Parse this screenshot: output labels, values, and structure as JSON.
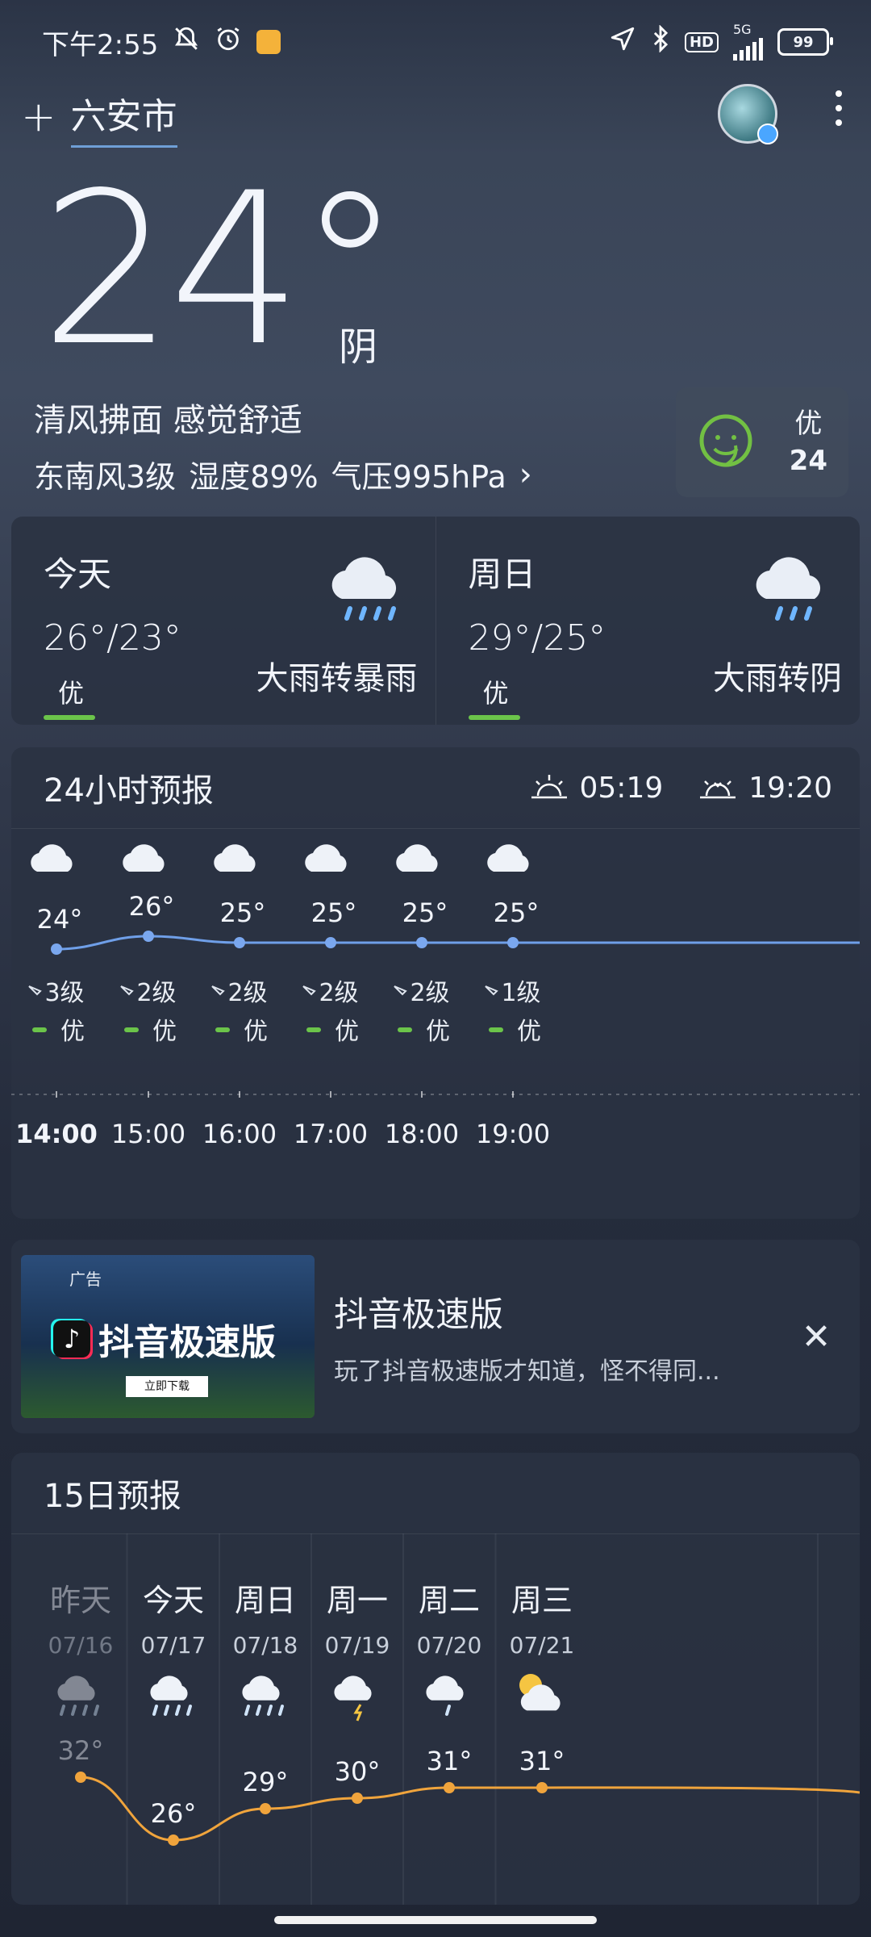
{
  "status_bar": {
    "time": "下午2:55",
    "hd": "HD",
    "network": "5G",
    "battery": "99"
  },
  "header": {
    "add": "+",
    "city": "六安市"
  },
  "current": {
    "temp": "24°",
    "condition": "阴",
    "feel": "清风拂面 感觉舒适",
    "wind": "东南风3级",
    "humidity": "湿度89%",
    "pressure": "气压995hPa",
    "aqi_label": "优",
    "aqi_value": "24"
  },
  "days": [
    {
      "name": "今天",
      "range": "26°/23°",
      "aqi": "优",
      "desc": "大雨转暴雨"
    },
    {
      "name": "周日",
      "range": "29°/25°",
      "aqi": "优",
      "desc": "大雨转阴"
    }
  ],
  "hourly": {
    "title": "24小时预报",
    "sunrise": "05:19",
    "sunset": "19:20",
    "items": [
      {
        "time": "14:00",
        "temp": "24°",
        "wind": "3级",
        "aqi": "优",
        "bold": true
      },
      {
        "time": "15:00",
        "temp": "26°",
        "wind": "2级",
        "aqi": "优"
      },
      {
        "time": "16:00",
        "temp": "25°",
        "wind": "2级",
        "aqi": "优"
      },
      {
        "time": "17:00",
        "temp": "25°",
        "wind": "2级",
        "aqi": "优"
      },
      {
        "time": "18:00",
        "temp": "25°",
        "wind": "2级",
        "aqi": "优"
      },
      {
        "time": "19:00",
        "temp": "25°",
        "wind": "1级",
        "aqi": "优"
      }
    ]
  },
  "ad": {
    "label": "广告",
    "image_title": "抖音极速版",
    "image_button": "立即下载",
    "title": "抖音极速版",
    "desc": "玩了抖音极速版才知道，怪不得同..."
  },
  "forecast15": {
    "title": "15日预报",
    "items": [
      {
        "day": "昨天",
        "date": "07/16",
        "temp": "32°",
        "icon": "rain-cloud-icon",
        "dim": true
      },
      {
        "day": "今天",
        "date": "07/17",
        "temp": "26°",
        "icon": "rain-cloud-icon"
      },
      {
        "day": "周日",
        "date": "07/18",
        "temp": "29°",
        "icon": "rain-cloud-icon"
      },
      {
        "day": "周一",
        "date": "07/19",
        "temp": "30°",
        "icon": "thunder-rain-icon"
      },
      {
        "day": "周二",
        "date": "07/20",
        "temp": "31°",
        "icon": "shower-icon"
      },
      {
        "day": "周三",
        "date": "07/21",
        "temp": "31°",
        "icon": "partly-cloudy-icon"
      }
    ]
  }
}
